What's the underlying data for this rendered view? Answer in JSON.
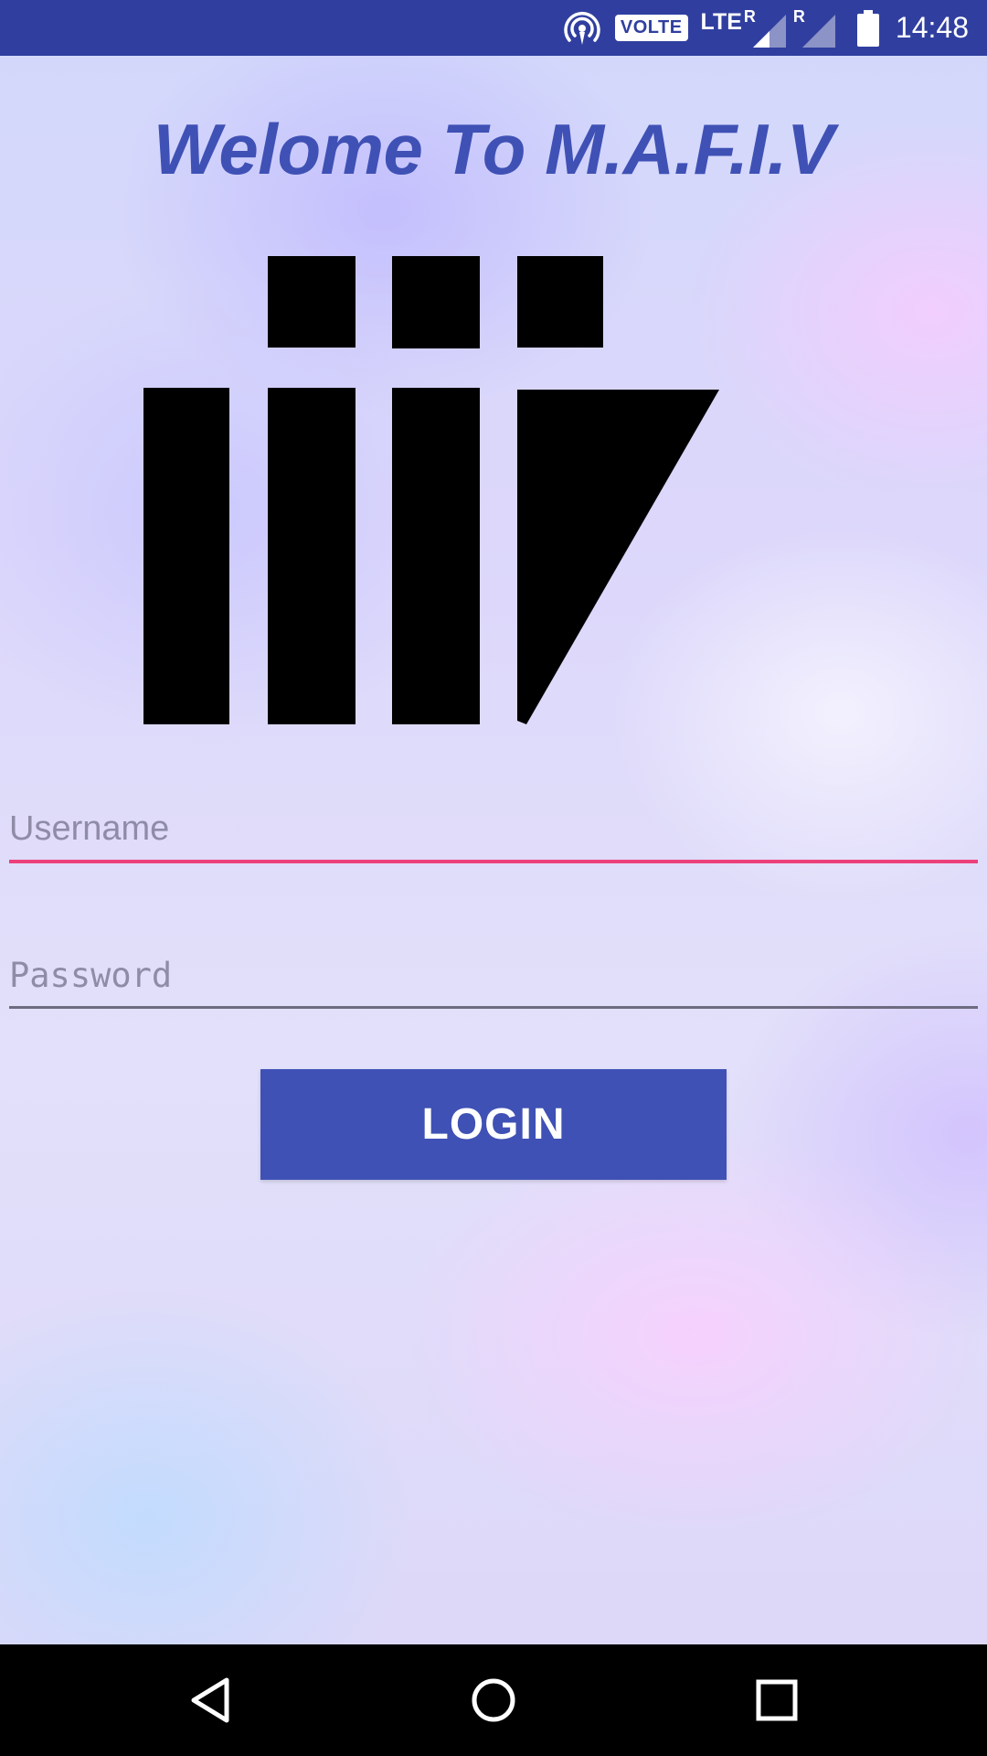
{
  "status_bar": {
    "icons": [
      "hotspot-icon",
      "volte-badge",
      "lte-signal-icon",
      "roaming-signal-icon",
      "battery-icon"
    ],
    "volte": "VOLTE",
    "network_type": "LTE",
    "roaming_1": "R",
    "roaming_2": "R",
    "time": "14:48",
    "background_color": "#303f9f"
  },
  "main": {
    "title": "Welome To M.A.F.I.V",
    "title_color": "#3f51b5",
    "logo": "iiiv-logo",
    "username": {
      "placeholder": "Username",
      "value": "",
      "underline_color": "#ec407a"
    },
    "password": {
      "placeholder": "Password",
      "value": ""
    },
    "login_button": {
      "label": "LOGIN",
      "color": "#3f51b5"
    }
  },
  "nav_bar": {
    "icons": [
      "back-icon",
      "home-icon",
      "recents-icon"
    ]
  }
}
